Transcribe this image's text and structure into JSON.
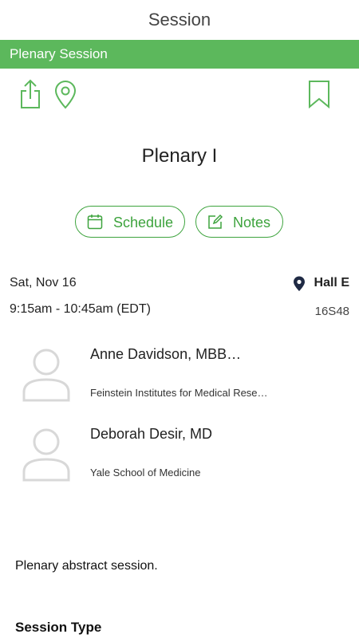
{
  "header": {
    "title": "Session"
  },
  "banner": {
    "label": "Plenary Session"
  },
  "session": {
    "title": "Plenary I",
    "date": "Sat, Nov 16",
    "time": "9:15am - 10:45am  (EDT)",
    "location": "Hall E",
    "room": "16S48",
    "description": "Plenary abstract session."
  },
  "actions": {
    "schedule_label": "Schedule",
    "notes_label": "Notes"
  },
  "speakers": [
    {
      "name": "Anne Davidson, MBB…",
      "affiliation": "Feinstein Institutes for Medical Rese…"
    },
    {
      "name": "Deborah Desir, MD",
      "affiliation": "Yale School of Medicine"
    }
  ],
  "sections": {
    "session_type": "Session Type"
  },
  "colors": {
    "accent": "#5cb85c",
    "button_text": "#3da33d",
    "location_pin": "#1f2a44"
  },
  "icons": [
    "share-icon",
    "map-pin-icon",
    "bookmark-icon",
    "calendar-icon",
    "edit-note-icon",
    "location-pin-icon",
    "avatar-placeholder-icon"
  ]
}
